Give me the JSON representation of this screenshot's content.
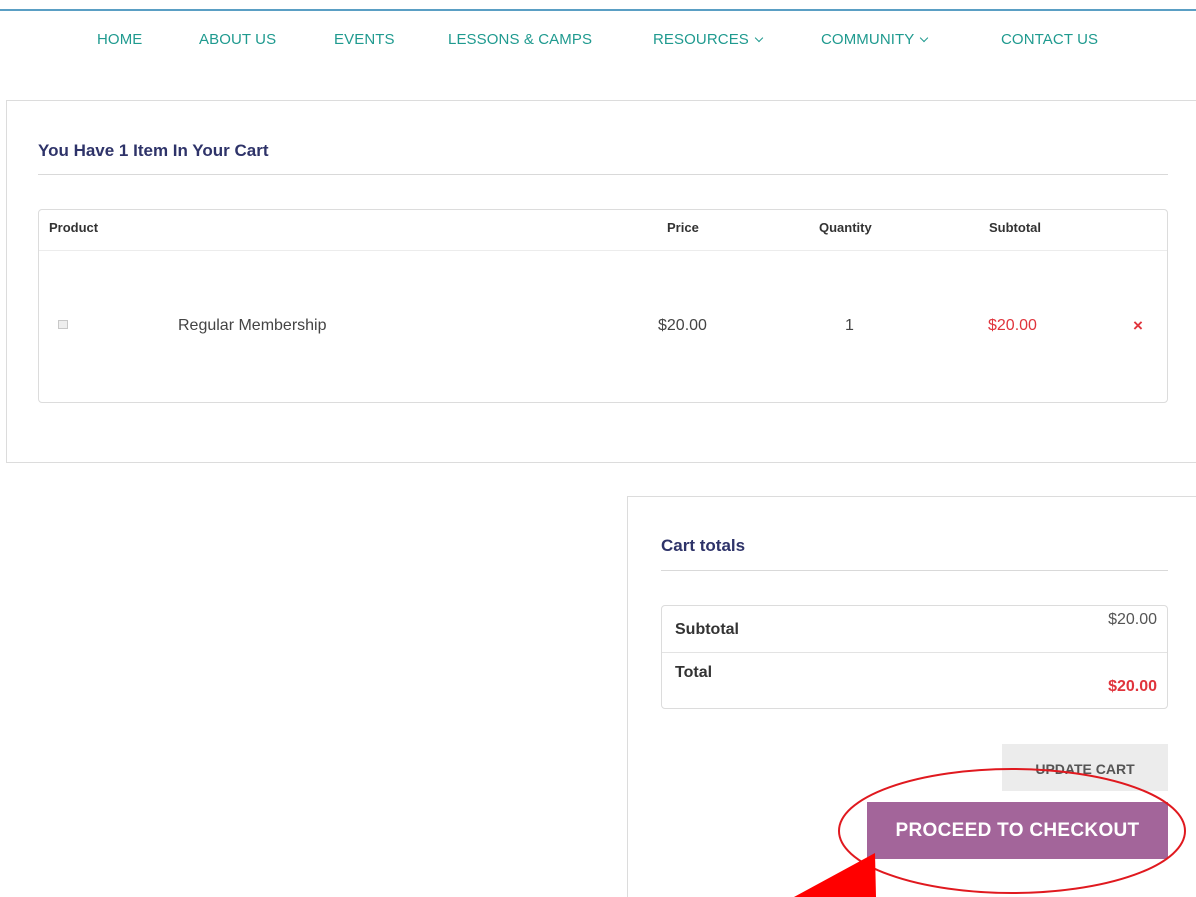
{
  "nav": {
    "items": [
      {
        "label": "HOME"
      },
      {
        "label": "ABOUT US"
      },
      {
        "label": "EVENTS"
      },
      {
        "label": "LESSONS & CAMPS"
      },
      {
        "label": "RESOURCES"
      },
      {
        "label": "COMMUNITY"
      },
      {
        "label": "CONTACT US"
      }
    ]
  },
  "cart": {
    "heading": "You Have 1 Item In Your Cart",
    "columns": {
      "product": "Product",
      "price": "Price",
      "quantity": "Quantity",
      "subtotal": "Subtotal"
    },
    "rows": [
      {
        "product_name": "Regular Membership",
        "price": "$20.00",
        "quantity": "1",
        "subtotal": "$20.00",
        "remove_symbol": "×"
      }
    ]
  },
  "totals": {
    "heading": "Cart totals",
    "subtotal_label": "Subtotal",
    "subtotal_value": "$20.00",
    "total_label": "Total",
    "total_value": "$20.00"
  },
  "buttons": {
    "update_cart": "UPDATE CART",
    "checkout": "PROCEED TO CHECKOUT"
  },
  "colors": {
    "nav_link": "#1f9a8f",
    "heading": "#2e3369",
    "price_red": "#e0343c",
    "checkout_bg": "#a3659a",
    "annotation_red": "#e0191f"
  },
  "icons": {
    "dropdown": "chevron-down-icon",
    "remove": "close-icon",
    "thumbnail": "image-placeholder-icon",
    "annotation_arrow": "arrow-icon"
  }
}
